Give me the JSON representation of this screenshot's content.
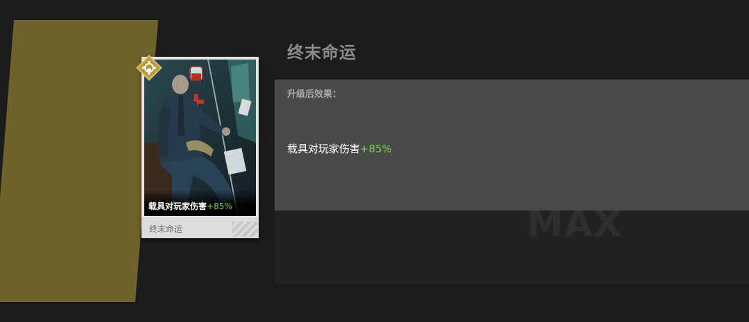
{
  "card": {
    "effect_text": "载具对玩家伤害",
    "effect_value": "+85%",
    "name": "终末命运"
  },
  "detail": {
    "title": "终末命运",
    "upgrade_label": "升级后效果：",
    "effect_text": "载具对玩家伤害",
    "effect_value": "+85%",
    "max_label": "MAX"
  },
  "colors": {
    "banner": "#6f622a",
    "badge": "#c9a84a",
    "positive_value": "#7dd34a",
    "panel": "#4a4a4a",
    "background": "#1c1c1c"
  },
  "icons": {
    "rarity_badge": "gear-emblem-icon"
  }
}
